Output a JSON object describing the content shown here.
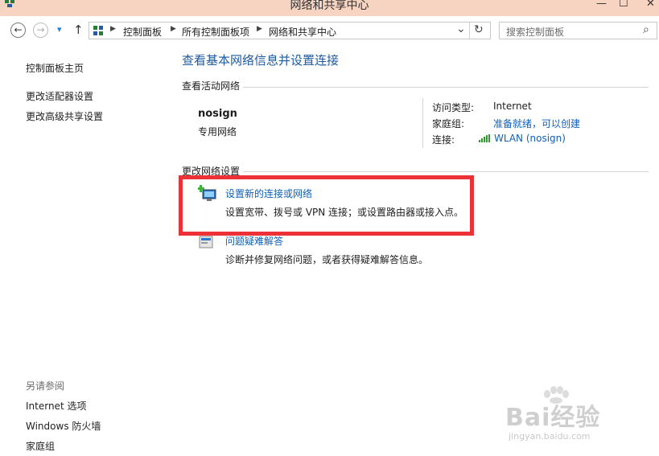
{
  "window": {
    "title": "网络和共享中心",
    "controls": {
      "minimize": "—",
      "maximize": "☐",
      "close": "✕"
    }
  },
  "nav": {
    "back": "←",
    "forward": "→",
    "dropdown": "▾",
    "up": "↑",
    "breadcrumbs": [
      "控制面板",
      "所有控制面板项",
      "网络和共享中心"
    ],
    "address_dropdown": "⌄",
    "refresh": "↻",
    "search_placeholder": "搜索控制面板",
    "search_icon": "⌕"
  },
  "sidebar": {
    "links": [
      "控制面板主页",
      "更改适配器设置",
      "更改高级共享设置"
    ],
    "see_also_title": "另请参阅",
    "see_also_links": [
      "Internet 选项",
      "Windows 防火墙",
      "家庭组"
    ]
  },
  "main": {
    "title": "查看基本网络信息并设置连接",
    "active_networks_title": "查看活动网络",
    "network": {
      "name": "nosign",
      "type": "专用网络",
      "access_type_label": "访问类型:",
      "access_type_value": "Internet",
      "homegroup_label": "家庭组:",
      "homegroup_value": "准备就绪，可以创建",
      "connections_label": "连接:",
      "connections_value": "WLAN (nosign)"
    },
    "change_settings_title": "更改网络设置",
    "tasks": [
      {
        "link": "设置新的连接或网络",
        "desc": "设置宽带、拨号或 VPN 连接；或设置路由器或接入点。"
      },
      {
        "link": "问题疑难解答",
        "desc": "诊断并修复网络问题，或者获得疑难解答信息。"
      }
    ]
  },
  "watermark": {
    "brand": "Bai经验",
    "url": "jingyan.baidu.com"
  },
  "colors": {
    "titlebar": "#f7d3c1",
    "link": "#1060b8",
    "highlight": "#ec3237"
  }
}
